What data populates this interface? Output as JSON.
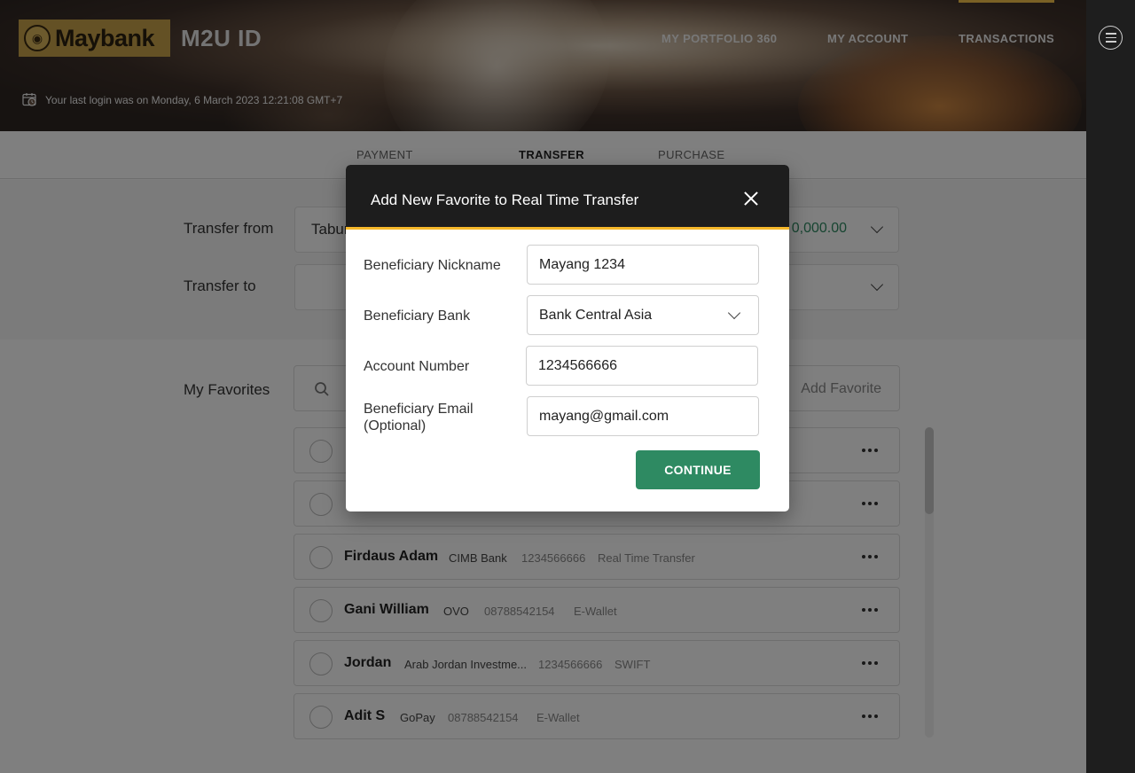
{
  "header": {
    "logo_text": "Maybank",
    "brand_sub": "M2U ID",
    "nav": [
      "MY PORTFOLIO 360",
      "MY ACCOUNT",
      "TRANSACTIONS"
    ],
    "active_nav": "TRANSACTIONS",
    "last_login": "Your last login was on Monday, 6 March 2023 12:21:08 GMT+7"
  },
  "tabs": [
    "PAYMENT",
    "TRANSFER",
    "PURCHASE"
  ],
  "active_tab": "TRANSFER",
  "transfer": {
    "from_label": "Transfer from",
    "from_value": "Tabun",
    "from_amount": "0,000.00",
    "to_label": "Transfer to",
    "to_value": ""
  },
  "favorites": {
    "label": "My Favorites",
    "search_placeholder": "",
    "add_label": "Add Favorite",
    "rows": [
      {
        "name": "",
        "bank": "",
        "account": "",
        "type": ""
      },
      {
        "name": "",
        "bank": "",
        "account": "",
        "type": ""
      },
      {
        "name": "Firdaus Adam",
        "bank": "CIMB Bank",
        "account": "1234566666",
        "type": "Real Time Transfer"
      },
      {
        "name": "Gani William",
        "bank": "OVO",
        "account": "08788542154",
        "type": "E-Wallet"
      },
      {
        "name": "Jordan",
        "bank": "Arab Jordan Investme...",
        "account": "1234566666",
        "type": "SWIFT"
      },
      {
        "name": "Adit S",
        "bank": "GoPay",
        "account": "08788542154",
        "type": "E-Wallet"
      }
    ]
  },
  "modal": {
    "title": "Add New Favorite to Real Time Transfer",
    "fields": [
      {
        "label": "Beneficiary Nickname",
        "value": "Mayang 1234"
      },
      {
        "label": "Beneficiary Bank",
        "value": "Bank Central Asia"
      },
      {
        "label": "Account Number",
        "value": "1234566666"
      },
      {
        "label": "Beneficiary Email (Optional)",
        "value": "mayang@gmail.com"
      }
    ],
    "continue_label": "CONTINUE"
  },
  "colors": {
    "accent_green": "#2e8a62",
    "brand_gold": "#c8a24a",
    "modal_header": "#1d1d1d",
    "modal_underline": "#f5b82a"
  },
  "icons": [
    "maybank-tiger-emblem-icon",
    "calendar-clock-icon",
    "menu-icon",
    "chevron-down-icon",
    "search-icon",
    "close-icon",
    "more-dots-icon"
  ]
}
